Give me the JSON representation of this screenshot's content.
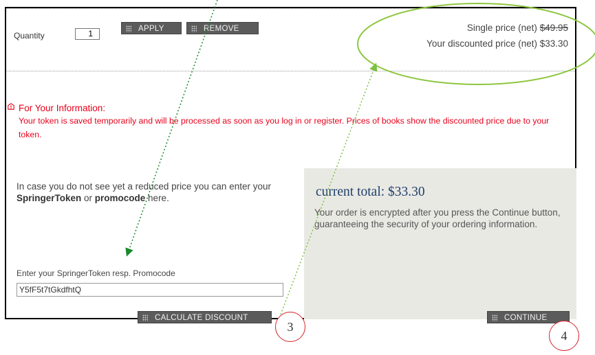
{
  "cart": {
    "quantity_label": "Quantity",
    "quantity_value": "1",
    "apply_label": "APPLY",
    "remove_label": "REMOVE",
    "single_price_label": "Single price (net)",
    "single_price_value": "$49.95",
    "discount_price_label": "Your discounted price (net) $33.30"
  },
  "info": {
    "title": "For Your Information:",
    "text": "Your token is saved temporarily and will be processed as soon as you log in or register. Prices of books show the discounted price due to your token."
  },
  "token": {
    "intro_1": "In case you do not see yet a reduced price you can enter your ",
    "intro_bold_1": "SpringerToken",
    "intro_2": " or ",
    "intro_bold_2": "promocode",
    "intro_3": " here.",
    "field_label": "Enter your SpringerToken resp. Promocode",
    "field_value": "Y5fF5t7tGkdfhtQ",
    "calculate_label": "CALCULATE DISCOUNT"
  },
  "summary": {
    "total": "current total: $33.30",
    "text": "Your order is encrypted after you press the Continue button, guaranteeing the security of your ordering information.",
    "continue_label": "CONTINUE"
  },
  "annotations": {
    "marker_3": "3",
    "marker_4": "4",
    "circle_color": "#8dc63f",
    "arrow_dark_color": "#1a8a2e",
    "arrow_light_color": "#7cc242",
    "marker_border_color": "#d4232a"
  }
}
